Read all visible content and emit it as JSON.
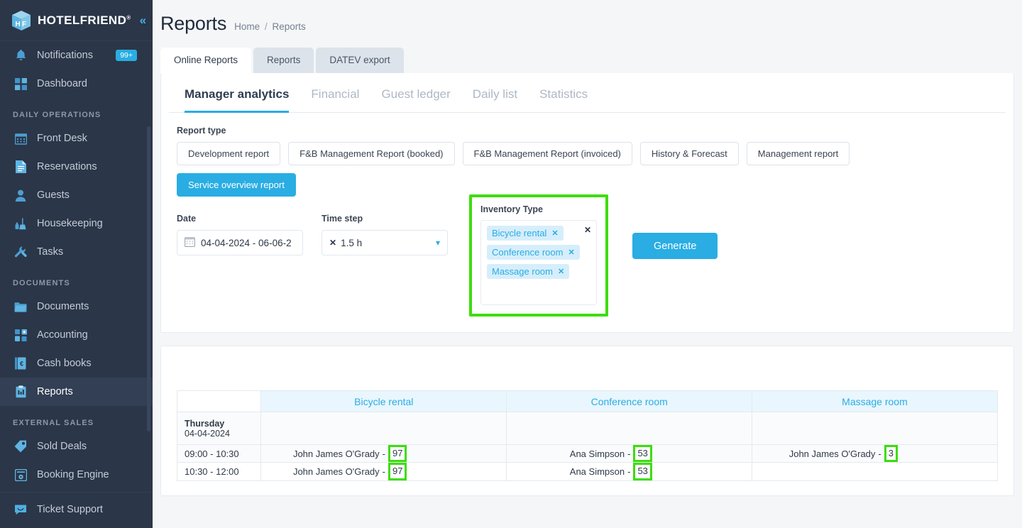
{
  "sidebar": {
    "brand": {
      "name": "HOTELFRIEND",
      "registered": "®",
      "collapse_icon": "chevron-double-left-icon"
    },
    "items": [
      {
        "label": "Notifications",
        "icon": "bell-icon",
        "badge": "99+",
        "active": false
      },
      {
        "label": "Dashboard",
        "icon": "grid-icon",
        "active": false
      }
    ],
    "groups": [
      {
        "title": "DAILY OPERATIONS",
        "items": [
          {
            "label": "Front Desk",
            "icon": "calendar-icon"
          },
          {
            "label": "Reservations",
            "icon": "document-icon"
          },
          {
            "label": "Guests",
            "icon": "person-icon"
          },
          {
            "label": "Housekeeping",
            "icon": "broom-icon"
          },
          {
            "label": "Tasks",
            "icon": "wrench-icon"
          }
        ]
      },
      {
        "title": "DOCUMENTS",
        "items": [
          {
            "label": "Documents",
            "icon": "folder-icon"
          },
          {
            "label": "Accounting",
            "icon": "accounting-icon"
          },
          {
            "label": "Cash books",
            "icon": "book-icon"
          },
          {
            "label": "Reports",
            "icon": "clipboard-icon",
            "active": true
          }
        ]
      },
      {
        "title": "EXTERNAL SALES",
        "items": [
          {
            "label": "Sold Deals",
            "icon": "tag-icon"
          },
          {
            "label": "Booking Engine",
            "icon": "engine-icon"
          },
          {
            "label": "Ticket Support",
            "icon": "chat-icon"
          }
        ]
      }
    ]
  },
  "header": {
    "title": "Reports",
    "breadcrumb": {
      "home": "Home",
      "separator": "/",
      "current": "Reports"
    }
  },
  "outer_tabs": [
    {
      "label": "Online Reports",
      "active": true
    },
    {
      "label": "Reports",
      "active": false
    },
    {
      "label": "DATEV export",
      "active": false
    }
  ],
  "inner_tabs": [
    {
      "label": "Manager analytics",
      "active": true
    },
    {
      "label": "Financial",
      "active": false
    },
    {
      "label": "Guest ledger",
      "active": false
    },
    {
      "label": "Daily list",
      "active": false
    },
    {
      "label": "Statistics",
      "active": false
    }
  ],
  "report_type": {
    "label": "Report type",
    "options": [
      {
        "label": "Development report",
        "selected": false
      },
      {
        "label": "F&B Management Report (booked)",
        "selected": false
      },
      {
        "label": "F&B Management Report (invoiced)",
        "selected": false
      },
      {
        "label": "History & Forecast",
        "selected": false
      },
      {
        "label": "Management report",
        "selected": false
      },
      {
        "label": "Service overview report",
        "selected": true
      }
    ]
  },
  "filters": {
    "date": {
      "label": "Date",
      "value": "04-04-2024 - 06-06-2",
      "icon": "calendar-icon"
    },
    "time_step": {
      "label": "Time step",
      "value": "1.5 h",
      "clear_icon": "x-icon",
      "chevron_icon": "chevron-down-icon"
    },
    "inventory_type": {
      "label": "Inventory Type",
      "clear_all_icon": "x-icon",
      "selected": [
        {
          "label": "Bicycle rental",
          "remove_icon": "x-icon"
        },
        {
          "label": "Conference room",
          "remove_icon": "x-icon"
        },
        {
          "label": "Massage room",
          "remove_icon": "x-icon"
        }
      ],
      "highlight_color": "#3ddd0a"
    },
    "generate_button": "Generate"
  },
  "results_table": {
    "columns": [
      "",
      "Bicycle rental",
      "Conference room",
      "Massage room"
    ],
    "day": {
      "weekday": "Thursday",
      "date": "04-04-2024"
    },
    "rows": [
      {
        "time": "09:00 - 10:30",
        "cells": [
          {
            "name": "John James O'Grady",
            "dash": "-",
            "value": "97",
            "highlight": true
          },
          {
            "name": "Ana Simpson",
            "dash": "-",
            "value": "53",
            "highlight": true
          },
          {
            "name": "John James O'Grady",
            "dash": "-",
            "value": "3",
            "highlight": true
          }
        ]
      },
      {
        "time": "10:30 - 12:00",
        "cells": [
          {
            "name": "John James O'Grady",
            "dash": "-",
            "value": "97",
            "highlight": true
          },
          {
            "name": "Ana Simpson",
            "dash": "-",
            "value": "53",
            "highlight": true
          },
          {
            "name": "",
            "dash": "",
            "value": "",
            "highlight": false
          }
        ]
      }
    ]
  },
  "colors": {
    "accent": "#29ade3",
    "sidebar_bg": "#2b3648",
    "highlight": "#3ddd0a",
    "page_bg": "#f4f6f8"
  }
}
